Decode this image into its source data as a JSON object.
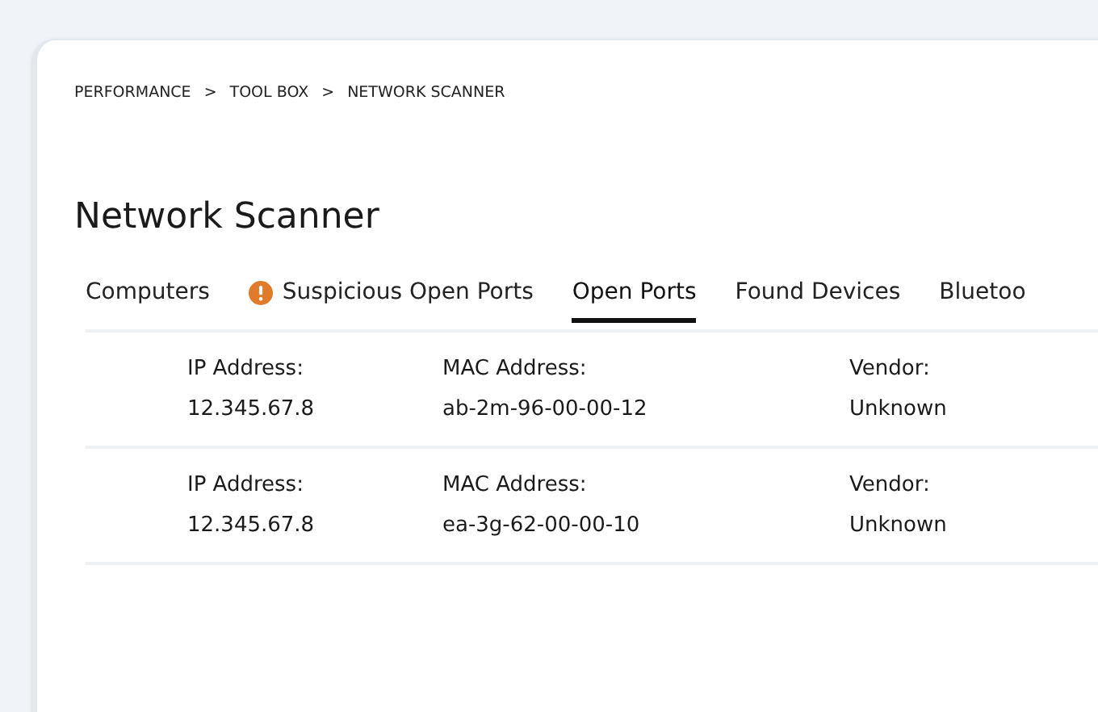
{
  "breadcrumb": [
    {
      "label": "PERFORMANCE",
      "separator": ">"
    },
    {
      "label": "TOOL BOX",
      "separator": ">"
    },
    {
      "label": "NETWORK SCANNER"
    }
  ],
  "title": "Network Scanner",
  "tabs": [
    {
      "label": "Computers",
      "selected": false,
      "warning": false
    },
    {
      "label": "Suspicious Open Ports",
      "selected": false,
      "warning": true
    },
    {
      "label": "Open Ports",
      "selected": true,
      "warning": false
    },
    {
      "label": "Found Devices",
      "selected": false,
      "warning": false
    },
    {
      "label": "Bluetoo",
      "selected": false,
      "warning": false
    }
  ],
  "devices": [
    {
      "fields": [
        {
          "label": "IP Address:",
          "value": "12.345.67.8"
        },
        {
          "label": "MAC Address:",
          "value": "ab-2m-96-00-00-12"
        },
        {
          "label": "Vendor:",
          "value": "Unknown"
        }
      ]
    },
    {
      "fields": [
        {
          "label": "IP Address:",
          "value": "12.345.67.8"
        },
        {
          "label": "MAC Address:",
          "value": "ea-3g-62-00-00-10"
        },
        {
          "label": "Vendor:",
          "value": "Unknown"
        }
      ]
    }
  ]
}
